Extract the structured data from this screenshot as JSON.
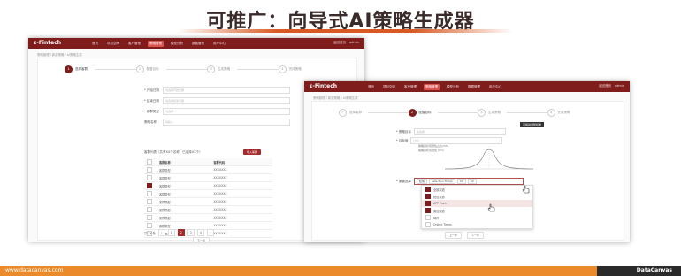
{
  "slide": {
    "title": "可推广：向导式AI策略生成器",
    "footer_url": "www.datacanvas.com",
    "footer_brand": "DataCanvas"
  },
  "app": {
    "logo": "ε-Fintech",
    "nav_items": [
      "首页",
      "项目空间",
      "客户管理",
      "策略管理",
      "模型分析",
      "数据管理",
      "用户中心"
    ],
    "nav_active_index": 3,
    "nav_right": [
      "返回首页",
      "admin"
    ],
    "breadcrumb": "策略管理 / 新建策略 / AI策略生成"
  },
  "left_screen": {
    "steps": [
      "选择客群",
      "配置目标",
      "生成策略",
      "完成策略"
    ],
    "active_step": 0,
    "form": [
      {
        "label": "* 开始日期",
        "placeholder": "请选择开始日期"
      },
      {
        "label": "* 结束日期",
        "placeholder": "请选择结束日期"
      },
      {
        "label": "* 客群类型",
        "placeholder": "请选择"
      },
      {
        "label": "策略名称",
        "placeholder": "请输入"
      }
    ],
    "table_title": "客群列表（共有XX个名称，已选择XX个）",
    "table_button": "导入客群",
    "table_headers": [
      "客群名称",
      "客群代码"
    ],
    "rows": [
      {
        "name": "客群类型",
        "code": "XXXXXXX",
        "checked": false
      },
      {
        "name": "客群类型",
        "code": "XXXXXXX",
        "checked": false
      },
      {
        "name": "客群类型",
        "code": "XXXXXXX",
        "checked": true
      },
      {
        "name": "客群类型",
        "code": "XXXXXXX",
        "checked": false
      },
      {
        "name": "客群类型",
        "code": "XXXXXXX",
        "checked": false
      },
      {
        "name": "客群类型",
        "code": "XXXXXXX",
        "checked": false
      },
      {
        "name": "客群类型",
        "code": "XXXXXXX",
        "checked": false
      },
      {
        "name": "客群类型",
        "code": "XXXXXXX",
        "checked": false
      },
      {
        "name": "客群类型",
        "code": "XXXXXXX",
        "checked": false
      }
    ],
    "pager": {
      "total": "共 XX 条",
      "pages": [
        "1",
        "2",
        "3",
        "4"
      ],
      "active": 1,
      "next": "下一步"
    }
  },
  "right_screen": {
    "steps": [
      "选择客群",
      "配置目标",
      "生成策略",
      "完成策略"
    ],
    "active_step": 1,
    "tooltip": "可拖动调整权重",
    "fields": [
      {
        "label": "* 策略目标",
        "value": "请选择"
      },
      {
        "label": "* 目标值",
        "value": "比例"
      }
    ],
    "chart_lines": [
      "策略目标值预估占比23%",
      "策略目标值预估 XX%"
    ],
    "select_label": "* 渠道选择",
    "select_tags": [
      "短信",
      "Selection Times",
      "XX",
      "XX"
    ],
    "dropdown_items": [
      "全部渠道",
      "短信渠道",
      "APP Push",
      "微信渠道",
      "邮件",
      "Online Times"
    ],
    "dropdown_checked": [
      true,
      true,
      true,
      true,
      false,
      false
    ],
    "dropdown_highlight": 2,
    "buttons": [
      "上一步",
      "下一步"
    ]
  }
}
